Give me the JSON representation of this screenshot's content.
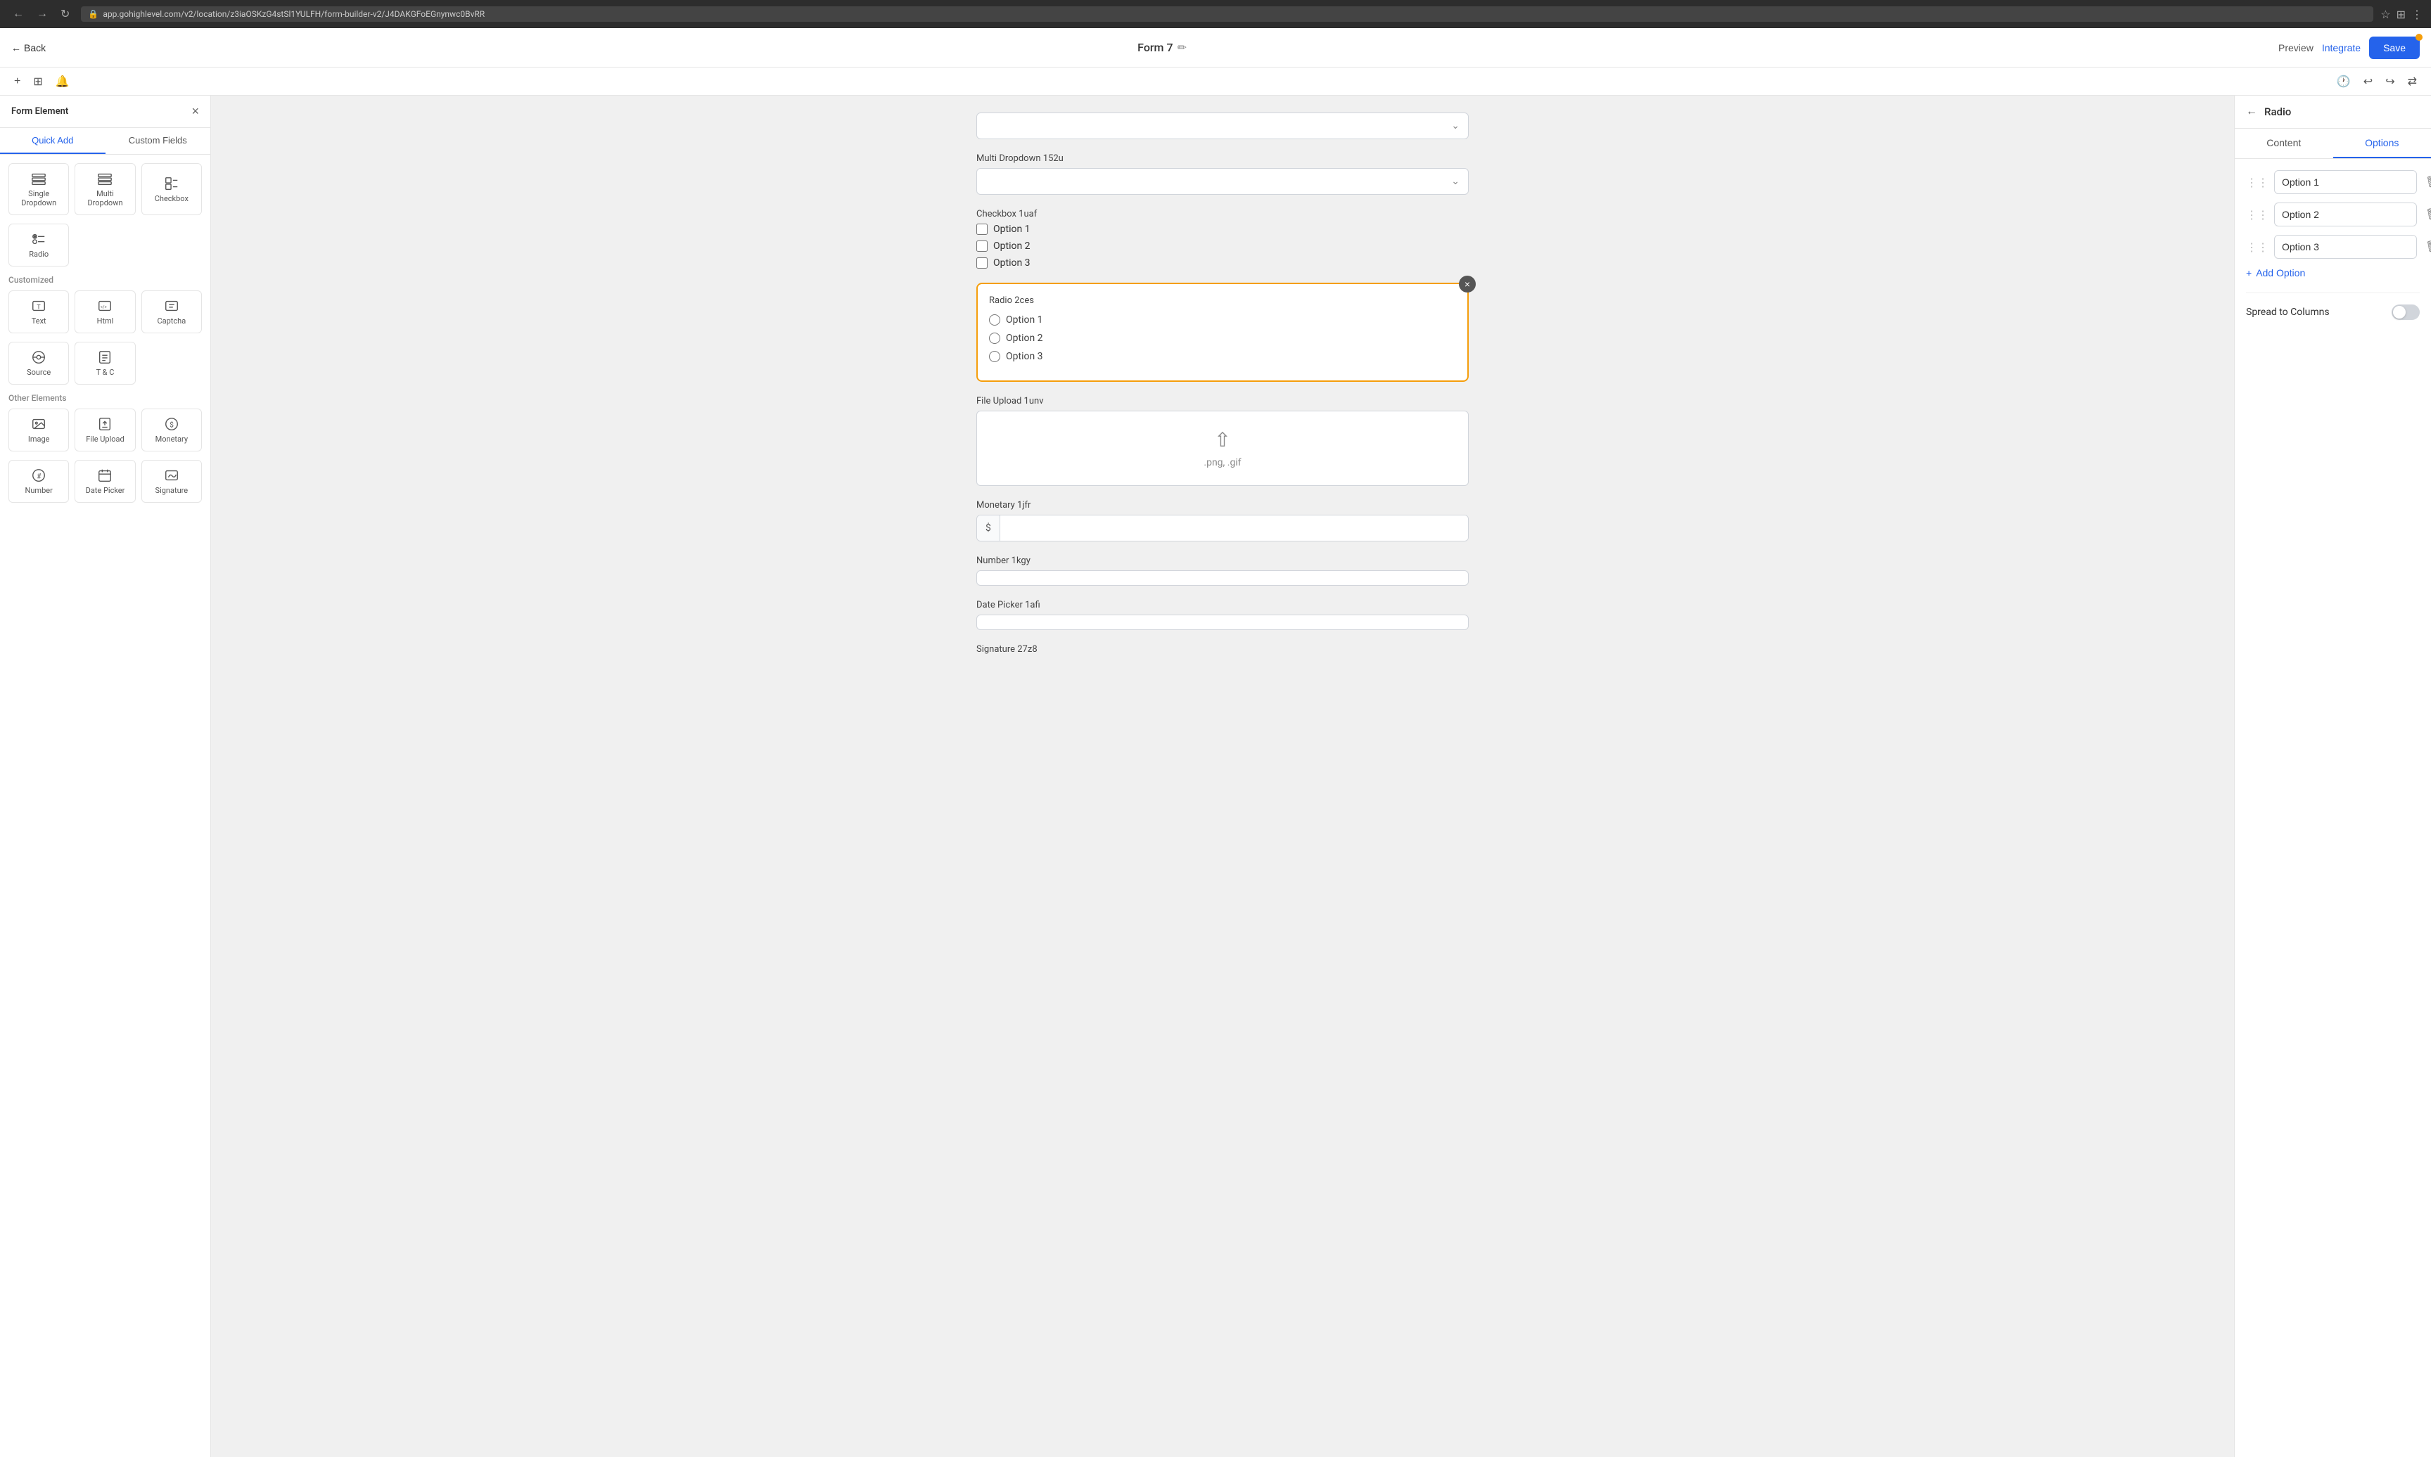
{
  "browser": {
    "url": "app.gohighlevel.com/v2/location/z3iaOSKzG4stSl1YULFH/form-builder-v2/J4DAKGFoEGnynwc0BvRR"
  },
  "header": {
    "back_label": "Back",
    "form_title": "Form 7",
    "preview_label": "Preview",
    "integrate_label": "Integrate",
    "save_label": "Save"
  },
  "left_panel": {
    "title": "Form Element",
    "tabs": [
      {
        "id": "quick-add",
        "label": "Quick Add"
      },
      {
        "id": "custom-fields",
        "label": "Custom Fields"
      }
    ],
    "sections": [
      {
        "label": "",
        "items": [
          {
            "id": "single-dropdown",
            "label": "Single Dropdown",
            "icon": "≡"
          },
          {
            "id": "multi-dropdown",
            "label": "Multi Dropdown",
            "icon": "≡"
          },
          {
            "id": "checkbox",
            "label": "Checkbox",
            "icon": "☑"
          }
        ]
      },
      {
        "label": "",
        "items": [
          {
            "id": "radio",
            "label": "Radio",
            "icon": "◉"
          }
        ]
      },
      {
        "label": "Customized",
        "items": [
          {
            "id": "text",
            "label": "Text",
            "icon": "T"
          },
          {
            "id": "html",
            "label": "Html",
            "icon": "</>"
          },
          {
            "id": "captcha",
            "label": "Captcha",
            "icon": "⊞"
          }
        ]
      },
      {
        "label": "",
        "items": [
          {
            "id": "source",
            "label": "Source",
            "icon": "⊙"
          },
          {
            "id": "tc",
            "label": "T & C",
            "icon": "≡"
          }
        ]
      },
      {
        "label": "Other Elements",
        "items": [
          {
            "id": "image",
            "label": "Image",
            "icon": "🖼"
          },
          {
            "id": "file-upload",
            "label": "File Upload",
            "icon": "⬆"
          },
          {
            "id": "monetary",
            "label": "Monetary",
            "icon": "$"
          }
        ]
      },
      {
        "label": "",
        "items": [
          {
            "id": "number",
            "label": "Number",
            "icon": "#"
          },
          {
            "id": "date-picker",
            "label": "Date Picker",
            "icon": "📅"
          },
          {
            "id": "signature",
            "label": "Signature",
            "icon": "✒"
          }
        ]
      }
    ]
  },
  "canvas": {
    "fields": [
      {
        "id": "multi-dropdown-top",
        "type": "dropdown",
        "label": "",
        "placeholder": ""
      },
      {
        "id": "multi-dropdown-152u",
        "type": "dropdown",
        "label": "Multi Dropdown 152u",
        "placeholder": ""
      },
      {
        "id": "checkbox-1uaf",
        "type": "checkbox",
        "label": "Checkbox 1uaf",
        "options": [
          "Option 1",
          "Option 2",
          "Option 3"
        ]
      },
      {
        "id": "radio-2ces",
        "type": "radio",
        "label": "Radio 2ces",
        "options": [
          "Option 1",
          "Option 2",
          "Option 3"
        ],
        "selected": true
      },
      {
        "id": "file-upload-1unv",
        "type": "file-upload",
        "label": "File Upload 1unv",
        "accept_text": ".png, .gif"
      },
      {
        "id": "monetary-1jfr",
        "type": "monetary",
        "label": "Monetary 1jfr",
        "prefix": "$"
      },
      {
        "id": "number-1kgy",
        "type": "number",
        "label": "Number 1kgy"
      },
      {
        "id": "date-picker-1afi",
        "type": "date",
        "label": "Date Picker 1afi"
      },
      {
        "id": "signature-27z8",
        "type": "signature",
        "label": "Signature 27z8"
      }
    ]
  },
  "right_panel": {
    "title": "Radio",
    "tabs": [
      {
        "id": "content",
        "label": "Content"
      },
      {
        "id": "options",
        "label": "Options"
      }
    ],
    "options": [
      {
        "id": "opt1",
        "value": "Option 1"
      },
      {
        "id": "opt2",
        "value": "Option 2"
      },
      {
        "id": "opt3",
        "value": "Option 3"
      }
    ],
    "add_option_label": "+ Add Option",
    "spread_label": "Spread to Columns"
  }
}
